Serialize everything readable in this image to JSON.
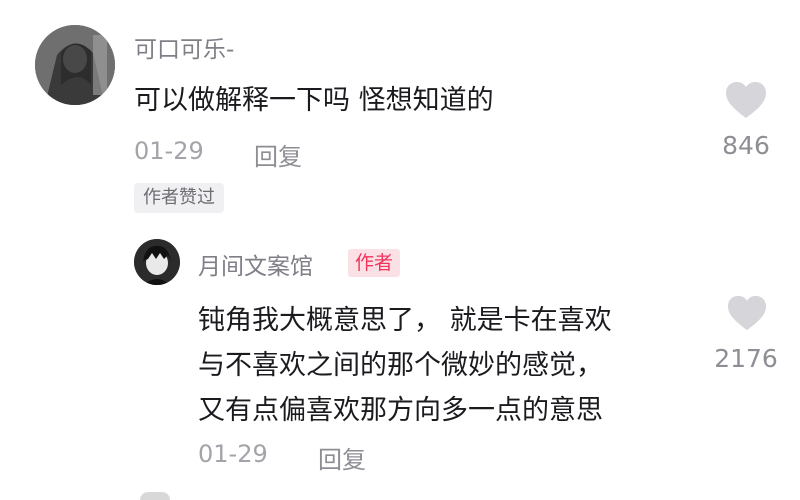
{
  "comments": [
    {
      "username": "可口可乐-",
      "text": "可以做解释一下吗 怪想知道的",
      "date": "01-29",
      "reply_label": "回复",
      "liked_tag": "作者赞过",
      "like_count": "846"
    },
    {
      "username": "月间文案馆",
      "badge": "作者",
      "text_lines": [
        "钝角我大概意思了， 就是卡在喜欢",
        "与不喜欢之间的那个微妙的感觉，",
        "又有点偏喜欢那方向多一点的意思"
      ],
      "date": "01-29",
      "reply_label": "回复",
      "like_count": "2176"
    }
  ],
  "icons": {
    "like": "heart-icon"
  },
  "colors": {
    "badge_text": "#f2335b",
    "badge_bg": "#fbe1e6",
    "heart": "#d6d6da"
  }
}
